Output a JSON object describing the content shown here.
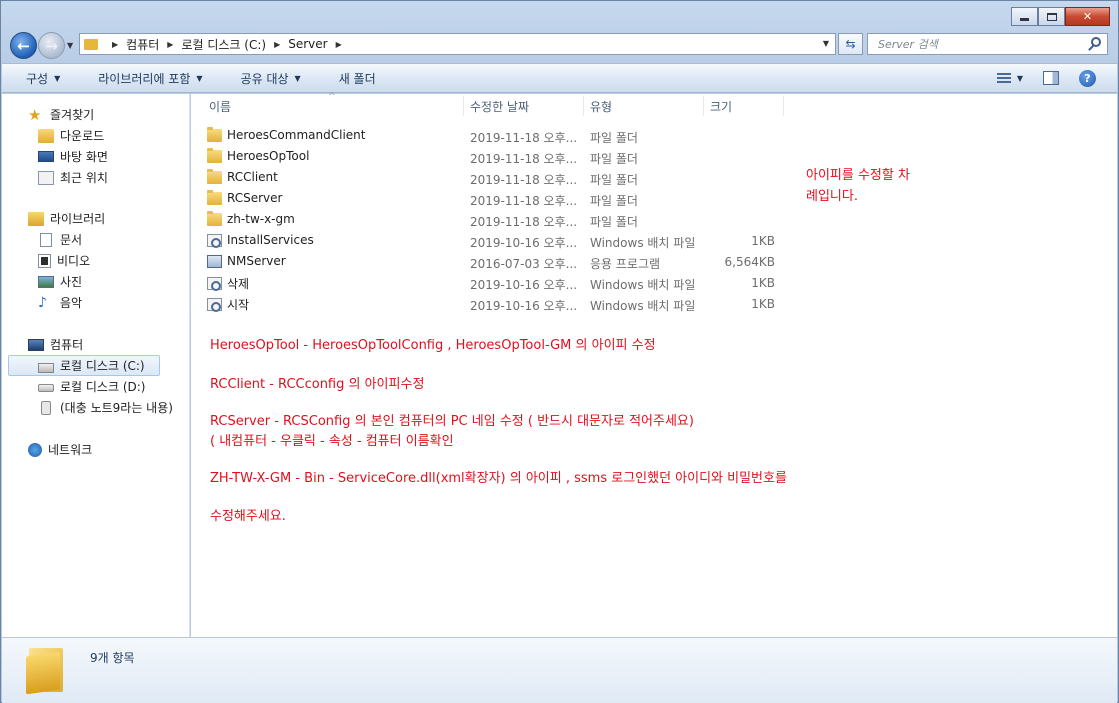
{
  "window": {
    "caption_buttons": [
      "minimize",
      "maximize",
      "close"
    ]
  },
  "address_bar": {
    "crumbs": [
      "컴퓨터",
      "로컬 디스크 (C:)",
      "Server"
    ]
  },
  "search": {
    "placeholder": "Server 검색"
  },
  "toolbar": {
    "organize": "구성",
    "include_library": "라이브러리에 포함",
    "share": "공유 대상",
    "new_folder": "새 폴더"
  },
  "sidebar": {
    "favorites": {
      "label": "즐겨찾기",
      "items": [
        "다운로드",
        "바탕 화면",
        "최근 위치"
      ]
    },
    "libraries": {
      "label": "라이브러리",
      "items": [
        "문서",
        "비디오",
        "사진",
        "음악"
      ]
    },
    "computer": {
      "label": "컴퓨터",
      "items": [
        "로컬 디스크 (C:)",
        "로컬 디스크 (D:)",
        "(대충 노트9라는 내용)"
      ]
    },
    "network": {
      "label": "네트워크"
    }
  },
  "columns": {
    "name": "이름",
    "modified": "수정한 날짜",
    "type": "유형",
    "size": "크기"
  },
  "files": [
    {
      "name": "HeroesCommandClient",
      "date": "2019-11-18 오후...",
      "type": "파일 폴더",
      "size": "",
      "icon": "folder-icon"
    },
    {
      "name": "HeroesOpTool",
      "date": "2019-11-18 오후...",
      "type": "파일 폴더",
      "size": "",
      "icon": "folder-icon"
    },
    {
      "name": "RCClient",
      "date": "2019-11-18 오후...",
      "type": "파일 폴더",
      "size": "",
      "icon": "folder-icon"
    },
    {
      "name": "RCServer",
      "date": "2019-11-18 오후...",
      "type": "파일 폴더",
      "size": "",
      "icon": "folder-icon"
    },
    {
      "name": "zh-tw-x-gm",
      "date": "2019-11-18 오후...",
      "type": "파일 폴더",
      "size": "",
      "icon": "folder-icon"
    },
    {
      "name": "InstallServices",
      "date": "2019-10-16 오후...",
      "type": "Windows 배치 파일",
      "size": "1KB",
      "icon": "batch-file-icon"
    },
    {
      "name": "NMServer",
      "date": "2016-07-03 오후...",
      "type": "응용 프로그램",
      "size": "6,564KB",
      "icon": "application-icon"
    },
    {
      "name": "삭제",
      "date": "2019-10-16 오후...",
      "type": "Windows 배치 파일",
      "size": "1KB",
      "icon": "batch-file-icon"
    },
    {
      "name": "시작",
      "date": "2019-10-16 오후...",
      "type": "Windows 배치 파일",
      "size": "1KB",
      "icon": "batch-file-icon"
    }
  ],
  "notes": {
    "side_1": "아이피를 수정할 차",
    "side_2": "례입니다.",
    "line_1": "HeroesOpTool - HeroesOpToolConfig , HeroesOpTool-GM 의 아이피 수정",
    "line_2": "RCClient - RCCconfig 의 아이피수정",
    "line_3": "RCServer - RCSConfig 의 본인 컴퓨터의 PC 네임 수정 ( 반드시 대문자로 적어주세요)",
    "line_4": "( 내컴퓨터 - 우클릭 - 속성 - 컴퓨터 이름확인",
    "line_5": "ZH-TW-X-GM - Bin - ServiceCore.dll(xml확장자) 의 아이피 , ssms 로그인했던 아이디와 비밀번호를",
    "line_6": "수정해주세요."
  },
  "details_pane": {
    "item_count": "9개 항목"
  },
  "colors": {
    "note_red": "#e0101c",
    "accent_blue": "#1f5fb5"
  }
}
